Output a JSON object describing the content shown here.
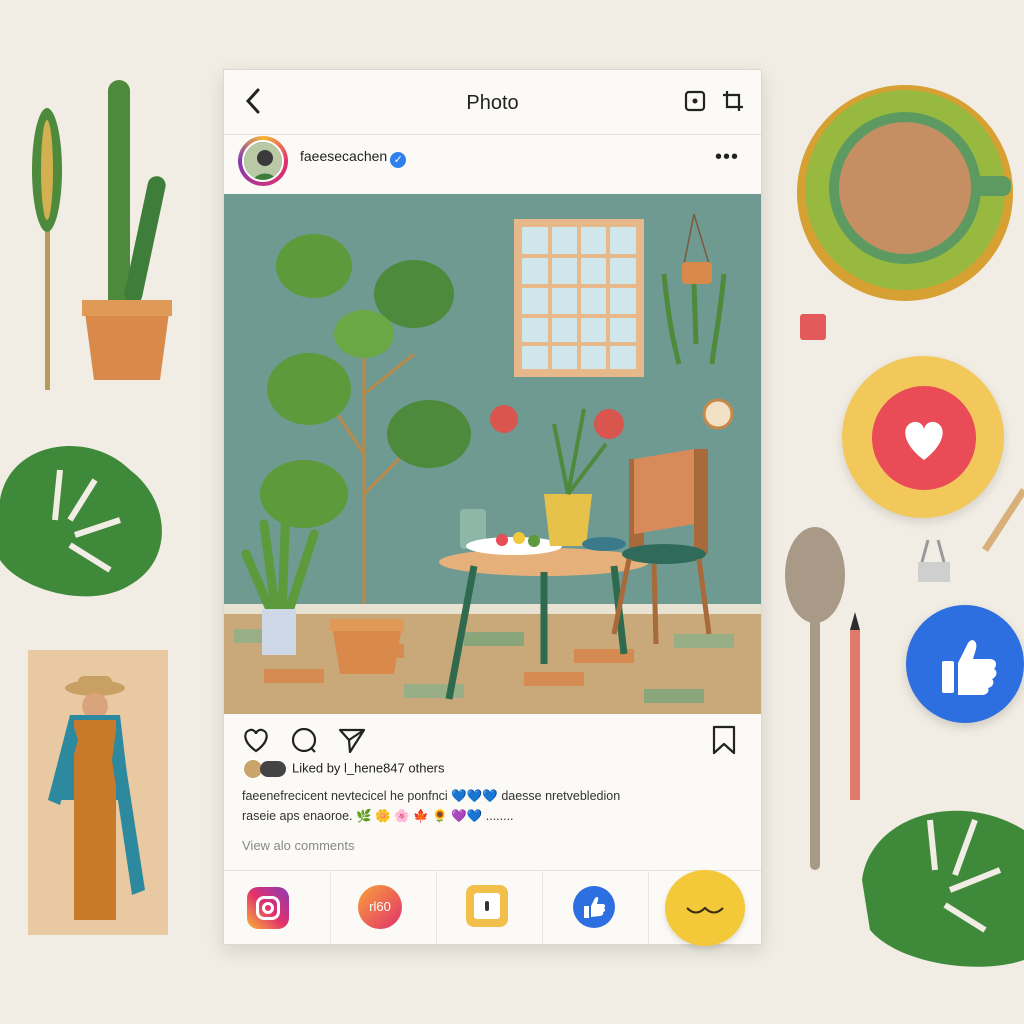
{
  "header": {
    "title": "Photo"
  },
  "post": {
    "username": "faeesecachen",
    "verified_mark": "✓",
    "more": "•••",
    "likes_text": "Liked by l_hene847 others",
    "caption_line1": "faeenefrecicent nevtecicel he ponfnci 💙💙💙 daesse nretvebledion",
    "caption_line2": "raseie aps enaoroe. 🌿 🌼 🌸 🍁 🌻 💜💙 ........",
    "view_comments": "View alo comments"
  },
  "bottom_bar": {
    "badge_text": "rl60"
  },
  "colors": {
    "like_red": "#e94b57",
    "thumb_blue": "#2d6fe0",
    "smile_yellow": "#f3c93a",
    "wall": "#6f9a92"
  },
  "icons": {
    "back": "chevron-left-icon",
    "share": "send-icon",
    "save": "bookmark-icon",
    "like": "heart-icon",
    "comment": "comment-icon"
  }
}
